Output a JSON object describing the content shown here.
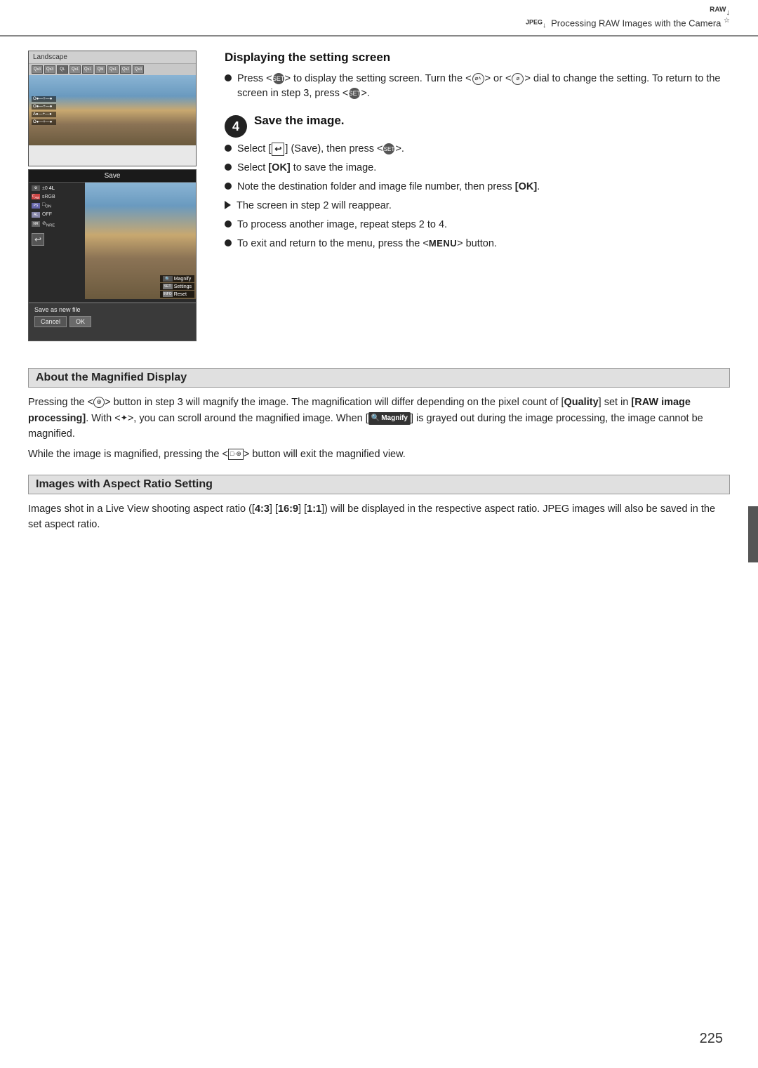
{
  "header": {
    "badge": "RAW↓\nJPEG↓",
    "title": "Processing RAW Images with the Camera"
  },
  "displaying_section": {
    "heading": "Displaying the setting screen",
    "bullets": [
      "Press < (SET) > to display the setting screen. Turn the < dial > or < dial > dial to change the setting. To return to the screen in step 3, press < (SET) >."
    ]
  },
  "save_section": {
    "step_number": "4",
    "heading": "Save the image.",
    "bullets": [
      "Select [save-icon] (Save), then press < (SET) >.",
      "Select [OK] to save the image.",
      "Note the destination folder and image file number, then press [OK].",
      "The screen in step 2 will reappear.",
      "To process another image, repeat steps 2 to 4.",
      "To exit and return to the menu, press the <MENU> button."
    ]
  },
  "screenshot1": {
    "label": "Landscape",
    "cam_icons": [
      "Q53",
      "Q53",
      "Q5L",
      "Q51",
      "Q51",
      "Q5M",
      "Q51",
      "Q52",
      "Q53"
    ],
    "params": [
      "O●●●●●",
      "O●●●●●",
      "A●●●●●",
      "O●●●●●"
    ]
  },
  "screenshot2": {
    "top_label": "Save",
    "params": [
      {
        "icon": "⚙",
        "label": "±0  4L"
      },
      {
        "icon": "□",
        "label": "sRGB"
      },
      {
        "icon": "□",
        "label": "□ON"
      },
      {
        "icon": "▲",
        "label": "OFF"
      },
      {
        "icon": "⊘",
        "label": "NR"
      }
    ],
    "buttons": [
      {
        "icon": "🔍",
        "label": "Magnify"
      },
      {
        "icon": "SET",
        "label": "Settings"
      },
      {
        "icon": "INFO",
        "label": "Reset"
      }
    ]
  },
  "screenshot3": {
    "label": "Save as new file",
    "cancel_label": "Cancel",
    "ok_label": "OK"
  },
  "magnified_section": {
    "heading": "About the Magnified Display",
    "body1": "Pressing the < 🔍 > button in step 3 will magnify the image. The magnification will differ depending on the pixel count of [Quality] set in [RAW image processing]. With < ✦ >, you can scroll around the magnified image. When [",
    "magnify_inline": "🔍 Magnify",
    "body2": "] is grayed out during the image processing, the image cannot be magnified.",
    "body3": "While the image is magnified, pressing the < □·🔍 > button will exit the magnified view."
  },
  "aspect_section": {
    "heading": "Images with Aspect Ratio Setting",
    "body": "Images shot in a Live View shooting aspect ratio ([4:3] [16:9] [1:1]) will be displayed in the respective aspect ratio. JPEG images will also be saved in the set aspect ratio."
  },
  "page_number": "225"
}
